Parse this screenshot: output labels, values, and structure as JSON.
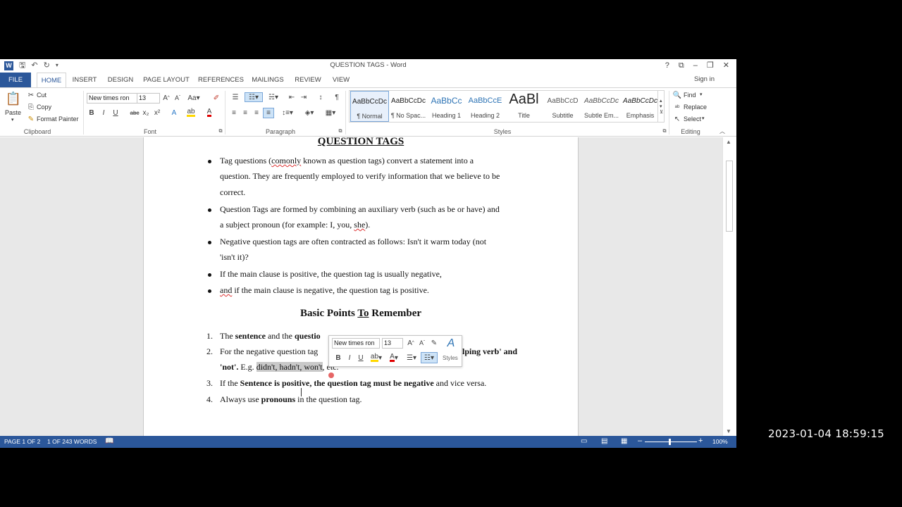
{
  "window": {
    "title": "QUESTION TAGS - Word",
    "controls": [
      "?",
      "⧉",
      "–",
      "❐",
      "✕"
    ]
  },
  "tabs": [
    "FILE",
    "HOME",
    "INSERT",
    "DESIGN",
    "PAGE LAYOUT",
    "REFERENCES",
    "MAILINGS",
    "REVIEW",
    "VIEW"
  ],
  "signin": "Sign in",
  "clipboard": {
    "paste": "Paste",
    "cut": "Cut",
    "copy": "Copy",
    "format_painter": "Format Painter",
    "label": "Clipboard"
  },
  "font": {
    "name": "New times ron",
    "size": "13",
    "label": "Font",
    "buttons": [
      "B",
      "I",
      "U",
      "abc",
      "x₂",
      "x²"
    ]
  },
  "paragraph": {
    "label": "Paragraph"
  },
  "styles": {
    "label": "Styles",
    "items": [
      {
        "preview": "AaBbCcDc",
        "name": "¶ Normal"
      },
      {
        "preview": "AaBbCcDc",
        "name": "¶ No Spac..."
      },
      {
        "preview": "AaBbCc",
        "name": "Heading 1"
      },
      {
        "preview": "AaBbCcE",
        "name": "Heading 2"
      },
      {
        "preview": "AaBl",
        "name": "Title"
      },
      {
        "preview": "AaBbCcD",
        "name": "Subtitle"
      },
      {
        "preview": "AaBbCcDc",
        "name": "Subtle Em..."
      },
      {
        "preview": "AaBbCcDc",
        "name": "Emphasis"
      }
    ]
  },
  "editing": {
    "find": "Find",
    "replace": "Replace",
    "select": "Select",
    "label": "Editing"
  },
  "document": {
    "heading": "QUESTION TAGS",
    "bullets": {
      "b1_l1a": "Tag questions (",
      "b1_l1b": "comonly",
      "b1_l1c": " known as question tags) convert a statement into a",
      "b1_l2": "question. They are frequently employed to verify information that we believe to be",
      "b1_l3": "correct.",
      "b2_l1": "Question Tags are formed by combining an auxiliary verb (such as be or have) and",
      "b2_l2a": "a subject pronoun (for example: I, you, ",
      "b2_l2b": "she",
      "b2_l2c": ").",
      "b3_l1": " Negative question tags are often contracted as follows: Isn't it warm today (not",
      "b3_l2": "'isn't it)?",
      "b4_l1": "If the main clause is positive, the question tag is usually negative,",
      "b5_l1a": "and",
      "b5_l1b": " if the main clause is negative, the question tag is positive."
    },
    "subheading_a": "Basic Points ",
    "subheading_b": "To",
    "subheading_c": " Remember",
    "points": {
      "n1": "1.",
      "p1a": "The ",
      "p1b": "sentence",
      "p1c": " and the ",
      "p1d": "questio",
      "n2": "2.",
      "p2a": "For  the  negative  question  tag",
      "p2b": "lping  verb'  and",
      "p2c": "'not'.",
      "p2d": " E.g. ",
      "p2e": "didn't, hadn't, won't",
      "p2f": ", etc.",
      "n3": "3.",
      "p3a": "If the ",
      "p3b": "Sentence is positive, the question tag must be negative",
      "p3c": " and vice versa.",
      "n4": "4.",
      "p4a": "Always use ",
      "p4b": "pronouns",
      "p4c": " in the question tag."
    }
  },
  "minitoolbar": {
    "font": "New times ron",
    "size": "13",
    "styles": "Styles"
  },
  "status": {
    "page": "PAGE 1 OF 2",
    "words": "1 OF 243 WORDS",
    "zoom": "100%"
  },
  "timestamp": "2023-01-04  18:59:15",
  "colors": {
    "accent": "#2b579a",
    "highlight_yellow": "#ffd800",
    "font_red": "#e00000"
  }
}
